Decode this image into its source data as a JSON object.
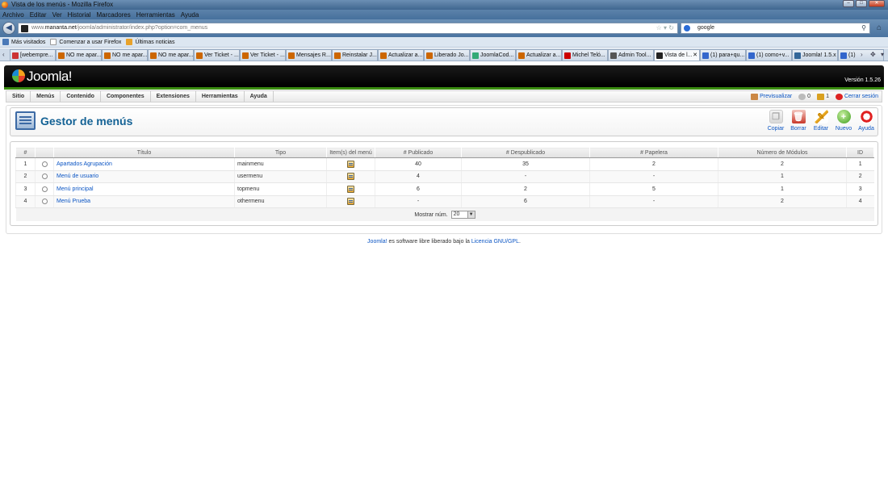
{
  "window": {
    "title": "Vista de los menús - Mozilla Firefox"
  },
  "menubar": [
    "Archivo",
    "Editar",
    "Ver",
    "Historial",
    "Marcadores",
    "Herramientas",
    "Ayuda"
  ],
  "urlbar": {
    "prefix": "www.",
    "domain": "mananta.net",
    "path": "/joomla/administrator/index.php?option=com_menus"
  },
  "searchbar": {
    "value": "google"
  },
  "bookmarks": [
    "Más visitados",
    "Comenzar a usar Firefox",
    "Últimas noticias"
  ],
  "tabs": [
    {
      "label": "[webempre...",
      "fav": "#c33"
    },
    {
      "label": "NO me apar...",
      "fav": "#c60"
    },
    {
      "label": "NO me apar...",
      "fav": "#c60"
    },
    {
      "label": "NO me apar...",
      "fav": "#c60"
    },
    {
      "label": "Ver Ticket - ...",
      "fav": "#c60"
    },
    {
      "label": "Ver Ticket - ...",
      "fav": "#c60"
    },
    {
      "label": "Mensajes R...",
      "fav": "#c60"
    },
    {
      "label": "Reinstalar J...",
      "fav": "#c60"
    },
    {
      "label": "Actualizar a...",
      "fav": "#c60"
    },
    {
      "label": "Liberado Jo...",
      "fav": "#c60"
    },
    {
      "label": "JoomlaCod...",
      "fav": "#3a7"
    },
    {
      "label": "Actualizar a...",
      "fav": "#c60"
    },
    {
      "label": "Michel Teló...",
      "fav": "#c00"
    },
    {
      "label": "Admin Tool...",
      "fav": "#555"
    },
    {
      "label": "Vista de l...",
      "fav": "#222"
    },
    {
      "label": "(1) para+qu...",
      "fav": "#36c"
    },
    {
      "label": "(1) como+v...",
      "fav": "#36c"
    },
    {
      "label": "Joomla! 1.5.x",
      "fav": "#369"
    },
    {
      "label": "(1)",
      "fav": "#36c"
    }
  ],
  "joomla": {
    "logo": "Joomla!",
    "version": "Versión 1.5.26",
    "menu": [
      "Sitio",
      "Menús",
      "Contenido",
      "Componentes",
      "Extensiones",
      "Herramientas",
      "Ayuda"
    ],
    "status": {
      "preview": "Previsualizar",
      "messages": "0",
      "users": "1",
      "logout": "Cerrar sesión"
    },
    "page_title": "Gestor de menús",
    "toolbar": [
      "Copiar",
      "Borrar",
      "Editar",
      "Nuevo",
      "Ayuda"
    ],
    "table": {
      "headers": [
        "#",
        "",
        "Título",
        "Tipo",
        "Item(s) del menú",
        "# Publicado",
        "# Despublicado",
        "# Papelera",
        "Número de Módulos",
        "ID"
      ],
      "rows": [
        {
          "num": "1",
          "title": "Apartados Agrupación",
          "type": "mainmenu",
          "published": "40",
          "unpublished": "35",
          "trash": "2",
          "modules": "2",
          "id": "1"
        },
        {
          "num": "2",
          "title": "Menú de usuario",
          "type": "usermenu",
          "published": "4",
          "unpublished": "-",
          "trash": "-",
          "modules": "1",
          "id": "2"
        },
        {
          "num": "3",
          "title": "Menú principal",
          "type": "topmenu",
          "published": "6",
          "unpublished": "2",
          "trash": "5",
          "modules": "1",
          "id": "3"
        },
        {
          "num": "4",
          "title": "Menú Prueba",
          "type": "othermenu",
          "published": "-",
          "unpublished": "6",
          "trash": "-",
          "modules": "2",
          "id": "4"
        }
      ],
      "footer_label": "Mostrar núm.",
      "limit": "20"
    },
    "footer": {
      "link1": "Joomla!",
      "text": " es software libre liberado bajo la ",
      "link2": "Licencia GNU/GPL",
      "end": "."
    }
  }
}
